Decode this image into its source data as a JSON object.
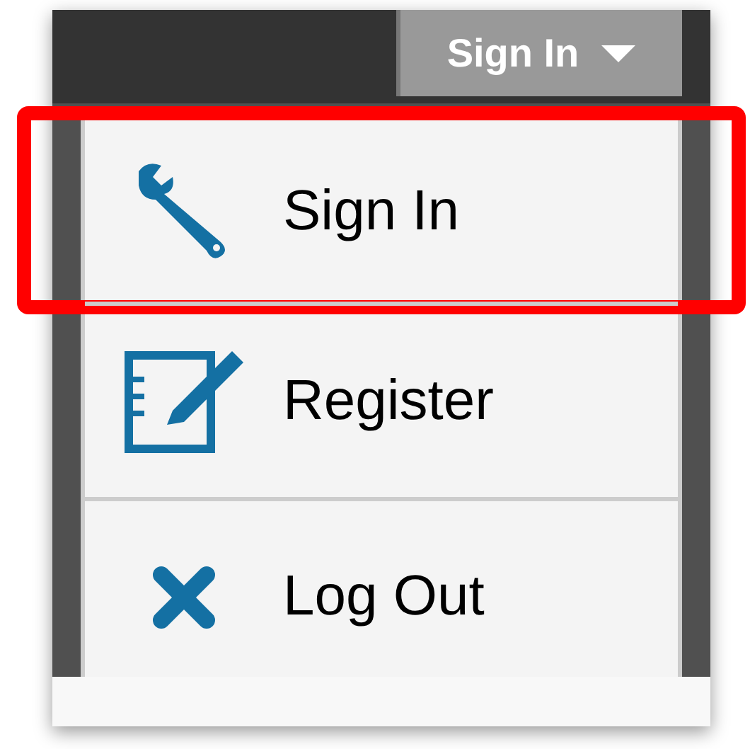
{
  "header": {
    "button": {
      "label": "Sign In",
      "expanded": true
    }
  },
  "menu": {
    "items": [
      {
        "label": "Sign In",
        "kind": "settings",
        "highlighted": true
      },
      {
        "label": "Register",
        "kind": "register",
        "highlighted": false
      },
      {
        "label": "Log Out",
        "kind": "logout",
        "highlighted": false
      }
    ]
  }
}
